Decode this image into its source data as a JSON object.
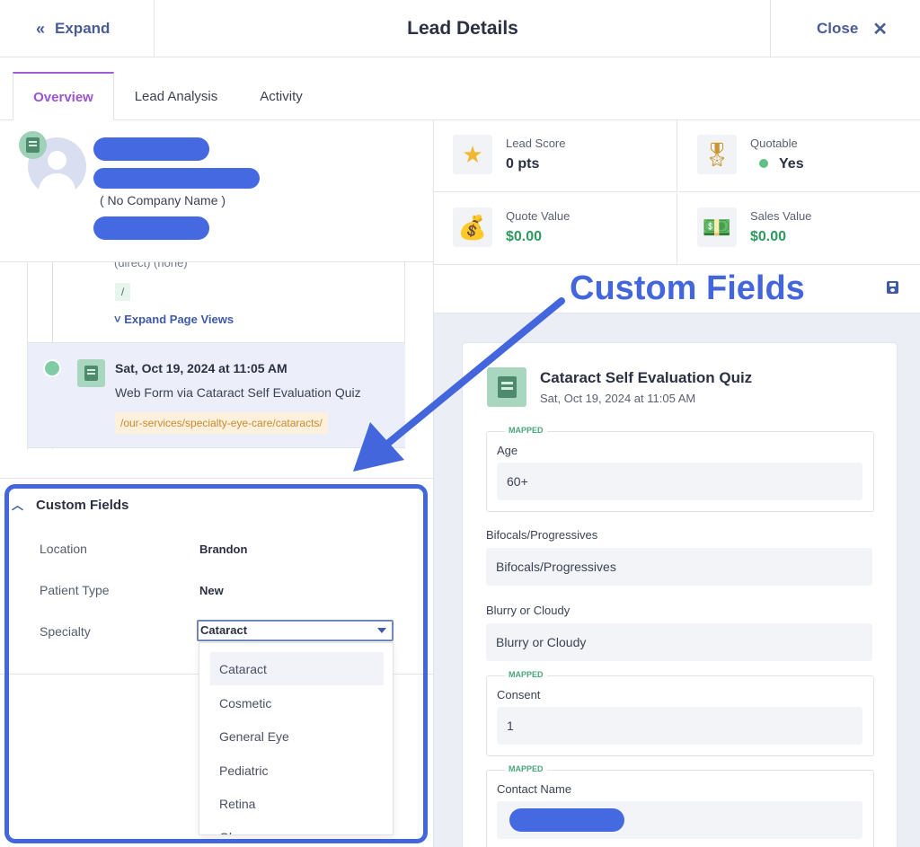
{
  "header": {
    "expand_label": "Expand",
    "title": "Lead Details",
    "close_label": "Close"
  },
  "tabs": [
    {
      "label": "Overview"
    },
    {
      "label": "Lead Analysis"
    },
    {
      "label": "Activity"
    }
  ],
  "profile": {
    "company": "( No Company Name )"
  },
  "timeline": {
    "source_text": "(direct) (none)",
    "path": "/",
    "expand_page_views": "Expand Page Views",
    "event": {
      "date": "Sat, Oct 19, 2024 at 11:05 AM",
      "description": "Web Form via Cataract Self Evaluation Quiz",
      "url": "/our-services/specialty-eye-care/cataracts/"
    }
  },
  "custom_fields": {
    "heading": "Custom Fields",
    "rows": [
      {
        "label": "Location",
        "value": "Brandon"
      },
      {
        "label": "Patient Type",
        "value": "New"
      },
      {
        "label": "Specialty",
        "value": "Cataract"
      }
    ],
    "dropdown_options": [
      "Cataract",
      "Cosmetic",
      "General Eye",
      "Pediatric",
      "Retina",
      "Glaucoma"
    ]
  },
  "metrics": [
    {
      "label": "Lead Score",
      "value": "0 pts",
      "icon": "star-icon"
    },
    {
      "label": "Quotable",
      "value": "Yes",
      "icon": "award-ribbon-icon"
    },
    {
      "label": "Quote Value",
      "value": "$0.00",
      "icon": "money-bag-icon"
    },
    {
      "label": "Sales Value",
      "value": "$0.00",
      "icon": "cash-stack-icon"
    }
  ],
  "form_card": {
    "title": "Cataract Self Evaluation Quiz",
    "date": "Sat, Oct 19, 2024 at 11:05 AM",
    "mapped_tag": "MAPPED",
    "fields": [
      {
        "label": "Age",
        "value": "60+",
        "mapped": true
      },
      {
        "label": "Bifocals/Progressives",
        "value": "Bifocals/Progressives",
        "mapped": false
      },
      {
        "label": "Blurry or Cloudy",
        "value": "Blurry or Cloudy",
        "mapped": false
      },
      {
        "label": "Consent",
        "value": "1",
        "mapped": true
      },
      {
        "label": "Contact Name",
        "value": "",
        "mapped": true
      }
    ]
  },
  "annotation": {
    "text": "Custom Fields",
    "color": "#4466dd"
  }
}
